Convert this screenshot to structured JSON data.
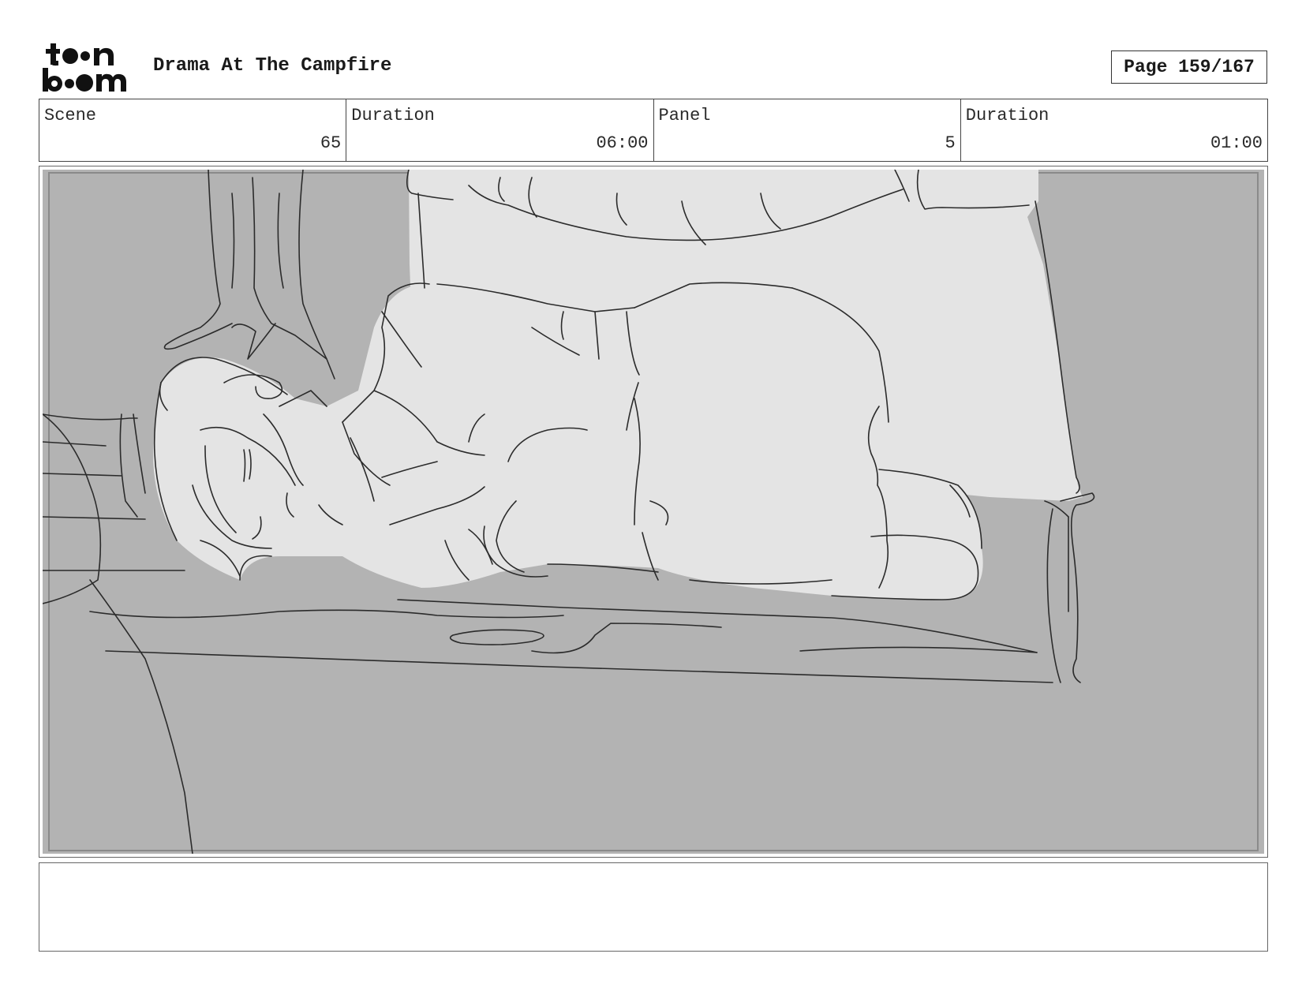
{
  "header": {
    "logo_icon": "toonboom-logo",
    "project_title": "Drama At The Campfire",
    "page_label": "Page 159/167"
  },
  "info": {
    "scene_label": "Scene",
    "scene_value": "65",
    "scene_duration_label": "Duration",
    "scene_duration_value": "06:00",
    "panel_label": "Panel",
    "panel_value": "5",
    "panel_duration_label": "Duration",
    "panel_duration_value": "01:00"
  },
  "panel": {
    "image_icon": "storyboard-sketch-sleeping-girl",
    "background_color": "#b3b3b3",
    "figure_color": "#e4e4e4"
  },
  "notes": {
    "text": ""
  }
}
